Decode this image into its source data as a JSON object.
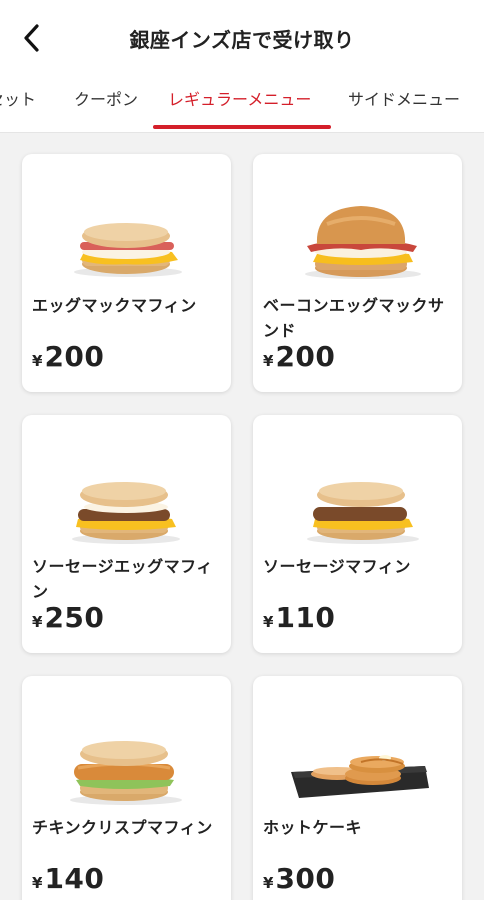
{
  "header": {
    "title": "銀座インズ店で受け取り"
  },
  "tabs": [
    {
      "label": "セット",
      "active": false
    },
    {
      "label": "クーポン",
      "active": false
    },
    {
      "label": "レギュラーメニュー",
      "active": true
    },
    {
      "label": "サイドメニュー",
      "active": false
    }
  ],
  "colors": {
    "accent": "#d41f2a",
    "background": "#f2f2f2",
    "card": "#ffffff"
  },
  "menu": {
    "items": [
      {
        "name": "エッグマックマフィン",
        "currency": "¥",
        "price": "200",
        "image": "egg-mcmuffin-image"
      },
      {
        "name": "ベーコンエッグマックサンド",
        "currency": "¥",
        "price": "200",
        "image": "bacon-egg-sandwich-image"
      },
      {
        "name": "ソーセージエッグマフィン",
        "currency": "¥",
        "price": "250",
        "image": "sausage-egg-muffin-image"
      },
      {
        "name": "ソーセージマフィン",
        "currency": "¥",
        "price": "110",
        "image": "sausage-muffin-image"
      },
      {
        "name": "チキンクリスプマフィン",
        "currency": "¥",
        "price": "140",
        "image": "chicken-crisp-muffin-image"
      },
      {
        "name": "ホットケーキ",
        "currency": "¥",
        "price": "300",
        "image": "hotcakes-image"
      }
    ]
  }
}
